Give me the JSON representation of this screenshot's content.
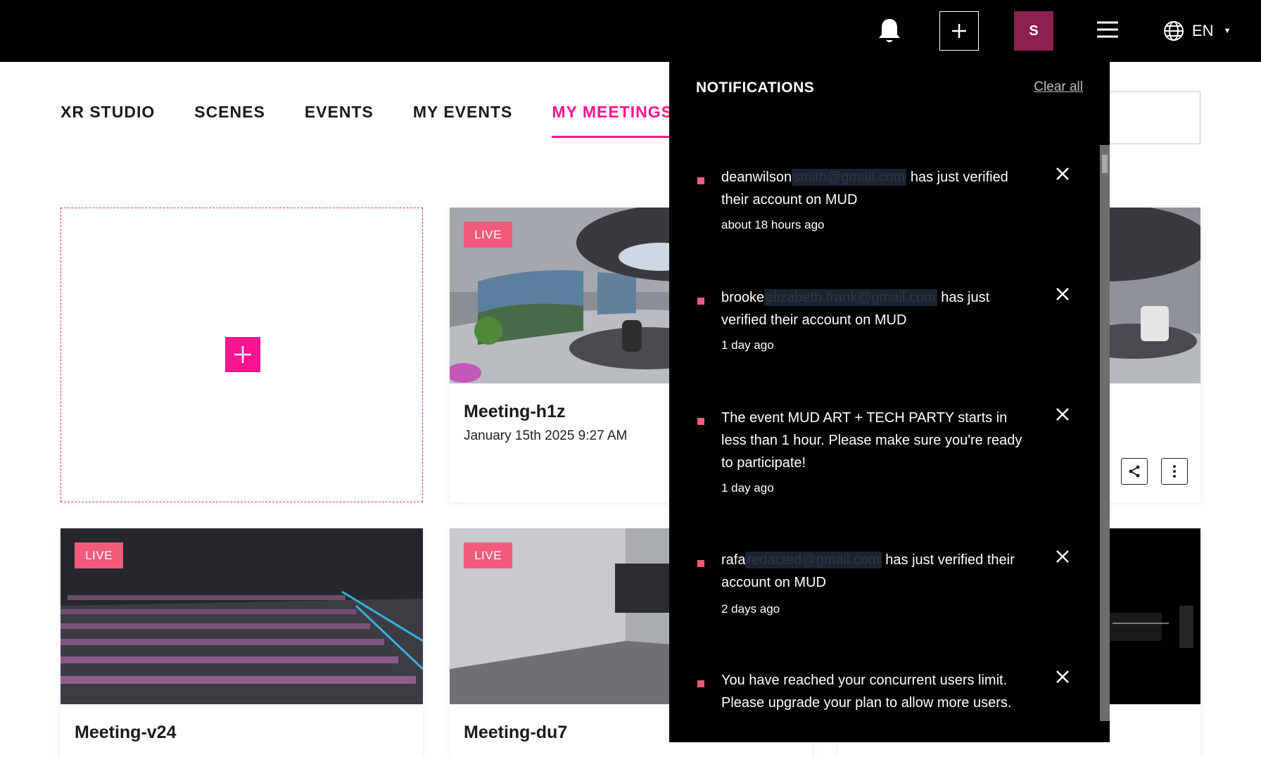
{
  "header": {
    "icons": [
      "bell-icon",
      "plus-icon",
      "menu-icon",
      "globe-icon"
    ],
    "avatar_initial": "S",
    "language": "EN",
    "colors": {
      "bar": "#000000",
      "avatar": "#8c2050",
      "accent": "#ff1493",
      "live": "#f25b7c"
    }
  },
  "tabs": [
    {
      "label": "XR STUDIO"
    },
    {
      "label": "SCENES"
    },
    {
      "label": "EVENTS"
    },
    {
      "label": "MY EVENTS"
    },
    {
      "label": "MY MEETINGS",
      "active": true
    }
  ],
  "live_label": "LIVE",
  "cards": [
    {
      "title": "Meeting-h1z",
      "date": "January 15th 2025 9:27 AM",
      "live": true
    },
    {
      "title": "Meeting-v24",
      "date": "",
      "live": true
    },
    {
      "title": "Meeting-du7",
      "date": "",
      "live": true
    }
  ],
  "notifications": {
    "title": "NOTIFICATIONS",
    "clear_label": "Clear all",
    "items": [
      {
        "user": "deanwilson",
        "redacted": "smith@gmail.com",
        "text": " has just verified their account on MUD",
        "time": "about 18 hours ago"
      },
      {
        "user": "brooke",
        "redacted": "elizabeth.frank@gmail.com",
        "text": " has just verified their account on MUD",
        "time": "1 day ago"
      },
      {
        "user": "",
        "redacted": "",
        "text": "The event MUD ART + TECH PARTY starts in less than 1 hour. Please make sure you're ready to participate!",
        "time": "1 day ago"
      },
      {
        "user": "rafa",
        "redacted": "redacted@gmail.com",
        "text": " has just verified their account on MUD",
        "time": "2 days ago"
      },
      {
        "user": "",
        "redacted": "",
        "text": "You have reached your concurrent users limit. Please upgrade your plan to allow more users.",
        "time": ""
      }
    ]
  }
}
